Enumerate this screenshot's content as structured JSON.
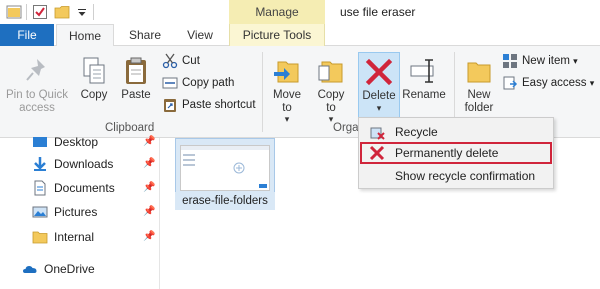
{
  "window": {
    "contextual_tab_group": "Manage",
    "title": "use file eraser"
  },
  "tabs": {
    "file": "File",
    "home": "Home",
    "share": "Share",
    "view": "View",
    "picture_tools": "Picture Tools"
  },
  "ribbon": {
    "pin_to_quick_access": "Pin to Quick access",
    "copy": "Copy",
    "paste": "Paste",
    "cut": "Cut",
    "copy_path": "Copy path",
    "paste_shortcut": "Paste shortcut",
    "clipboard_group": "Clipboard",
    "move_to": "Move to",
    "copy_to": "Copy to",
    "delete": "Delete",
    "rename": "Rename",
    "organize_group": "Orga",
    "new_folder": "New folder",
    "new_item": "New item",
    "easy_access": "Easy access"
  },
  "nav_pane": {
    "items": [
      {
        "label": "Desktop",
        "icon": "desktop-icon"
      },
      {
        "label": "Downloads",
        "icon": "downloads-icon"
      },
      {
        "label": "Documents",
        "icon": "documents-icon"
      },
      {
        "label": "Pictures",
        "icon": "pictures-icon"
      },
      {
        "label": "Internal",
        "icon": "folder-icon"
      },
      {
        "label": "OneDrive",
        "icon": "onedrive-icon"
      }
    ]
  },
  "content": {
    "file_name": "erase-file-folders"
  },
  "delete_menu": {
    "items": [
      {
        "label": "Recycle",
        "icon": "recycle-bin-icon"
      },
      {
        "label": "Permanently delete",
        "icon": "red-x-icon"
      },
      {
        "label": "Show recycle confirmation",
        "icon": ""
      }
    ]
  },
  "colors": {
    "file_tab": "#1e6fc0",
    "contextual_tab": "#f5edb3",
    "highlight_border": "#d0253b",
    "delete_x": "#d0253b"
  }
}
